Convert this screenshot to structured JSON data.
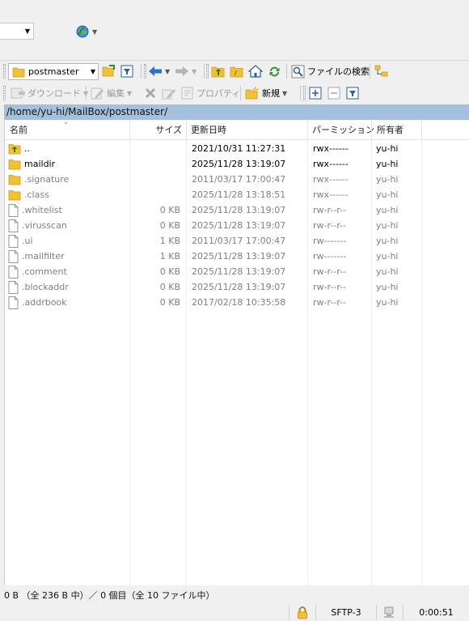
{
  "toolbar_top": {
    "session_combo_value": ""
  },
  "toolbar1": {
    "location": "postmaster",
    "find_files_label": "ファイルの検索"
  },
  "toolbar2": {
    "download_label": "ダウンロード",
    "edit_label": "編集",
    "properties_label": "プロパティ",
    "new_label": "新規"
  },
  "current_path": "/home/yu-hi/MailBox/postmaster/",
  "columns": {
    "name": "名前",
    "size": "サイズ",
    "modified": "更新日時",
    "permissions": "パーミッション",
    "owner": "所有者"
  },
  "files": [
    {
      "name": "..",
      "type": "parent",
      "size": "",
      "modified": "2021/10/31 11:27:31",
      "permissions": "rwx------",
      "owner": "yu-hi",
      "hidden": false
    },
    {
      "name": "maildir",
      "type": "folder",
      "size": "",
      "modified": "2025/11/28 13:19:07",
      "permissions": "rwx------",
      "owner": "yu-hi",
      "hidden": false
    },
    {
      "name": ".signature",
      "type": "folder",
      "size": "",
      "modified": "2011/03/17 17:00:47",
      "permissions": "rwx------",
      "owner": "yu-hi",
      "hidden": true
    },
    {
      "name": ".class",
      "type": "folder",
      "size": "",
      "modified": "2025/11/28 13:18:51",
      "permissions": "rwx------",
      "owner": "yu-hi",
      "hidden": true
    },
    {
      "name": ".whitelist",
      "type": "file",
      "size": "0 KB",
      "modified": "2025/11/28 13:19:07",
      "permissions": "rw-r--r--",
      "owner": "yu-hi",
      "hidden": true
    },
    {
      "name": ".virusscan",
      "type": "file",
      "size": "0 KB",
      "modified": "2025/11/28 13:19:07",
      "permissions": "rw-r--r--",
      "owner": "yu-hi",
      "hidden": true
    },
    {
      "name": ".ui",
      "type": "file",
      "size": "1 KB",
      "modified": "2011/03/17 17:00:47",
      "permissions": "rw-------",
      "owner": "yu-hi",
      "hidden": true
    },
    {
      "name": ".mailfilter",
      "type": "file",
      "size": "1 KB",
      "modified": "2025/11/28 13:19:07",
      "permissions": "rw-------",
      "owner": "yu-hi",
      "hidden": true
    },
    {
      "name": ".comment",
      "type": "file",
      "size": "0 KB",
      "modified": "2025/11/28 13:19:07",
      "permissions": "rw-r--r--",
      "owner": "yu-hi",
      "hidden": true
    },
    {
      "name": ".blockaddr",
      "type": "file",
      "size": "0 KB",
      "modified": "2025/11/28 13:19:07",
      "permissions": "rw-r--r--",
      "owner": "yu-hi",
      "hidden": true
    },
    {
      "name": ".addrbook",
      "type": "file",
      "size": "0 KB",
      "modified": "2017/02/18 10:35:58",
      "permissions": "rw-r--r--",
      "owner": "yu-hi",
      "hidden": true
    }
  ],
  "status": {
    "selection_summary": "0 B （全 236 B 中）／ 0 個目（全 10 ファイル中）",
    "protocol": "SFTP-3",
    "elapsed": "0:00:51"
  },
  "colors": {
    "path_bar": "#a5c0dc",
    "folder": "#f2c233",
    "hidden_text": "#808080"
  }
}
